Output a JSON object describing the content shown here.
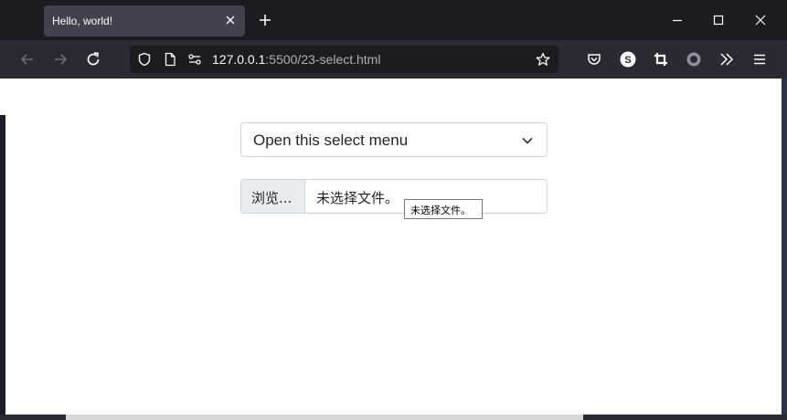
{
  "tab": {
    "title": "Hello, world!"
  },
  "urlbar": {
    "host": "127.0.0.1",
    "rest": ":5500/23-select.html"
  },
  "page": {
    "select": {
      "selected": "Open this select menu"
    },
    "file_input": {
      "button_label": "浏览...",
      "status": "未选择文件。"
    },
    "tooltip": "未选择文件。"
  },
  "icons": {
    "tab_close": "close-icon",
    "new_tab": "plus-icon",
    "minimize": "minimize-icon",
    "maximize": "maximize-icon",
    "close_window": "close-icon",
    "back": "arrow-left-icon",
    "forward": "arrow-right-icon",
    "reload": "reload-icon",
    "shield": "shield-icon",
    "page": "page-icon",
    "permissions": "permissions-icon",
    "bookmark": "star-icon",
    "pocket": "pocket-icon",
    "extension_s": "extension-s-icon",
    "crop": "crop-icon",
    "record": "record-icon",
    "overflow": "chevron-double-right-icon",
    "menu": "hamburger-menu-icon"
  },
  "colors": {
    "tabstrip": "#1c1b22",
    "navbar": "#2b2a33",
    "active_tab": "#42414d",
    "page_bg": "#ffffff"
  }
}
